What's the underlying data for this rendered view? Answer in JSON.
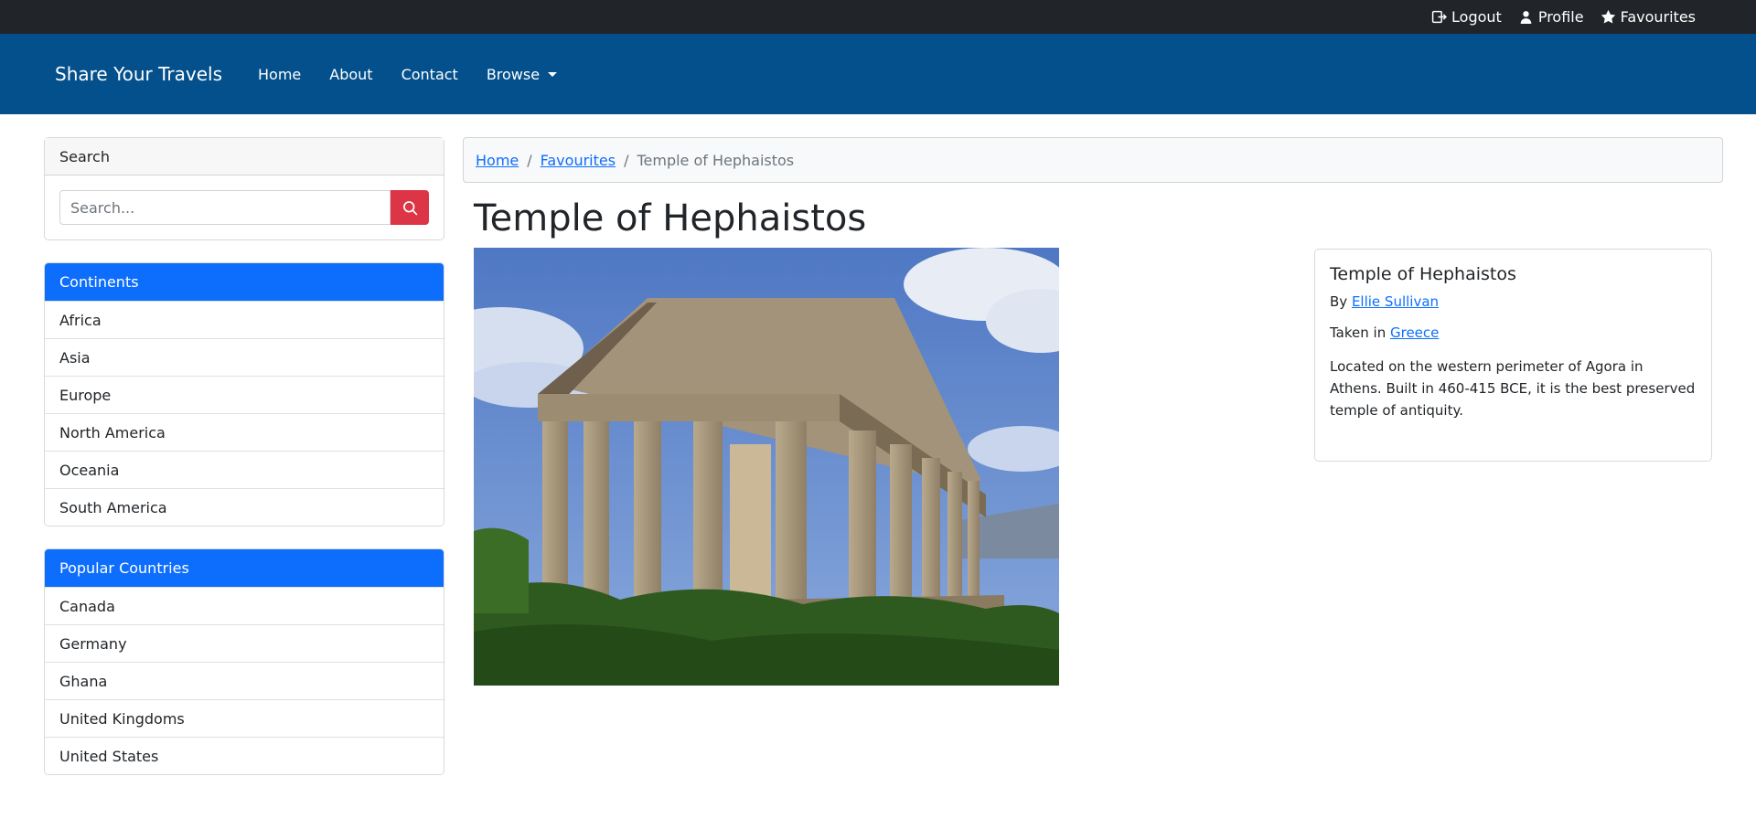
{
  "topbar": {
    "logout": "Logout",
    "profile": "Profile",
    "favourites": "Favourites"
  },
  "navbar": {
    "brand": "Share Your Travels",
    "links": [
      "Home",
      "About",
      "Contact",
      "Browse"
    ]
  },
  "search": {
    "header": "Search",
    "placeholder": "Search..."
  },
  "continents": {
    "header": "Continents",
    "items": [
      "Africa",
      "Asia",
      "Europe",
      "North America",
      "Oceania",
      "South America"
    ]
  },
  "countries": {
    "header": "Popular Countries",
    "items": [
      "Canada",
      "Germany",
      "Ghana",
      "United Kingdoms",
      "United States"
    ]
  },
  "breadcrumb": {
    "home": "Home",
    "favourites": "Favourites",
    "current": "Temple of Hephaistos",
    "separator": "/"
  },
  "photo": {
    "title": "Temple of Hephaistos",
    "by_label": "By",
    "author": "Ellie Sullivan",
    "taken_label": "Taken in",
    "country": "Greece",
    "description": "Located on the western perimeter of Agora in Athens. Built in 460-415 BCE, it is the best preserved temple of antiquity."
  },
  "colors": {
    "topbar": "#212529",
    "navbar": "#03508c",
    "primary": "#0d6efd",
    "danger": "#dc3545"
  }
}
